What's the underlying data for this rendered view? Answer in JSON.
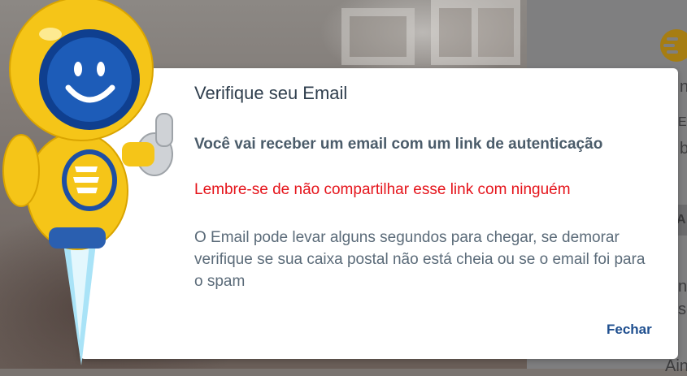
{
  "modal": {
    "title": "Verifique seu Email",
    "subtitle": "Você vai receber um email com um link de autenticação",
    "warning": "Lembre-se de não compartilhar esse link com ninguém",
    "body": "O Email pode levar alguns segundos para chegar, se demorar verifique se sua caixa postal não está cheia ou se o email foi para o spam",
    "close_label": "Fechar"
  },
  "background_panel": {
    "fragments": [
      "nt",
      "E-",
      "b",
      "A",
      "n",
      "so",
      "Ain"
    ]
  },
  "colors": {
    "title": "#2f3e4d",
    "subtitle": "#4b5c6a",
    "warning": "#e5141b",
    "body": "#5b6b79",
    "close_button": "#1f4f8f",
    "mascot_yellow": "#f5c518",
    "mascot_visor": "#1d4fa3",
    "overlay": "#7f7f80"
  },
  "icons": {
    "mascot": "astronaut-mascot-icon",
    "panel_logo": "brand-logo-icon"
  }
}
